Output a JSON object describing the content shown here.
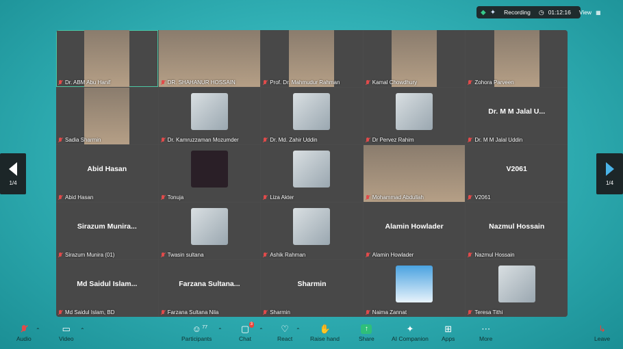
{
  "topbar": {
    "recording_label": "Recording",
    "timer": "01:12:16",
    "view_label": "View"
  },
  "pager": {
    "left": "1/4",
    "right": "1/4"
  },
  "participants": [
    {
      "name": "Dr. ABM Abu Hanif",
      "display": "",
      "kind": "video",
      "active": true
    },
    {
      "name": "DR. SHAHANUR HOSSAIN",
      "display": "",
      "kind": "video-full"
    },
    {
      "name": "Prof. Dr. Mahmudur Rahman",
      "display": "",
      "kind": "video"
    },
    {
      "name": "Kamal Chowdhury",
      "display": "",
      "kind": "video"
    },
    {
      "name": "Zohora Parveen",
      "display": "",
      "kind": "video"
    },
    {
      "name": "Sadia Sharmin",
      "display": "",
      "kind": "video"
    },
    {
      "name": "Dr. Kamruzzaman Mozumder",
      "display": "",
      "kind": "thumb"
    },
    {
      "name": "Dr. Md. Zahir Uddin",
      "display": "",
      "kind": "thumb"
    },
    {
      "name": "Dr Pervez Rahim",
      "display": "",
      "kind": "thumb"
    },
    {
      "name": "Dr. M M Jalal Uddin",
      "display": "Dr. M M Jalal U...",
      "kind": "name"
    },
    {
      "name": "Abid Hasan",
      "display": "Abid Hasan",
      "kind": "name"
    },
    {
      "name": "Tonuja",
      "display": "",
      "kind": "thumb-dark"
    },
    {
      "name": "Liza Akter",
      "display": "",
      "kind": "thumb"
    },
    {
      "name": "Mohammad Abdullah",
      "display": "",
      "kind": "video-full"
    },
    {
      "name": "V2061",
      "display": "V2061",
      "kind": "name"
    },
    {
      "name": "Sirazum Munira (01)",
      "display": "Sirazum Munira...",
      "kind": "name"
    },
    {
      "name": "Twasin sultana",
      "display": "",
      "kind": "thumb"
    },
    {
      "name": "Ashik Rahman",
      "display": "",
      "kind": "thumb"
    },
    {
      "name": "Alamin Howlader",
      "display": "Alamin Howlader",
      "kind": "name"
    },
    {
      "name": "Nazmul Hossain",
      "display": "Nazmul Hossain",
      "kind": "name"
    },
    {
      "name": "Md Saidul Islam, BD",
      "display": "Md Saidul Islam...",
      "kind": "name"
    },
    {
      "name": "Farzana Sultana Nila",
      "display": "Farzana Sultana...",
      "kind": "name"
    },
    {
      "name": "Sharmin",
      "display": "Sharmin",
      "kind": "name"
    },
    {
      "name": "Naima Zannat",
      "display": "",
      "kind": "thumb-sky"
    },
    {
      "name": "Teresa Tithi",
      "display": "",
      "kind": "thumb"
    }
  ],
  "toolbar": {
    "audio": "Audio",
    "video": "Video",
    "participants": "Participants",
    "participants_count": "77",
    "chat": "Chat",
    "chat_badge": "3",
    "react": "React",
    "raise_hand": "Raise hand",
    "share": "Share",
    "ai_companion": "AI Companion",
    "apps": "Apps",
    "more": "More",
    "leave": "Leave"
  },
  "colors": {
    "background": "#33b3b8",
    "grid": "#4b4b4b",
    "muted_mic": "#e14b4b",
    "recording_dot": "#e8443a",
    "active_outline": "#4cc7a3"
  }
}
